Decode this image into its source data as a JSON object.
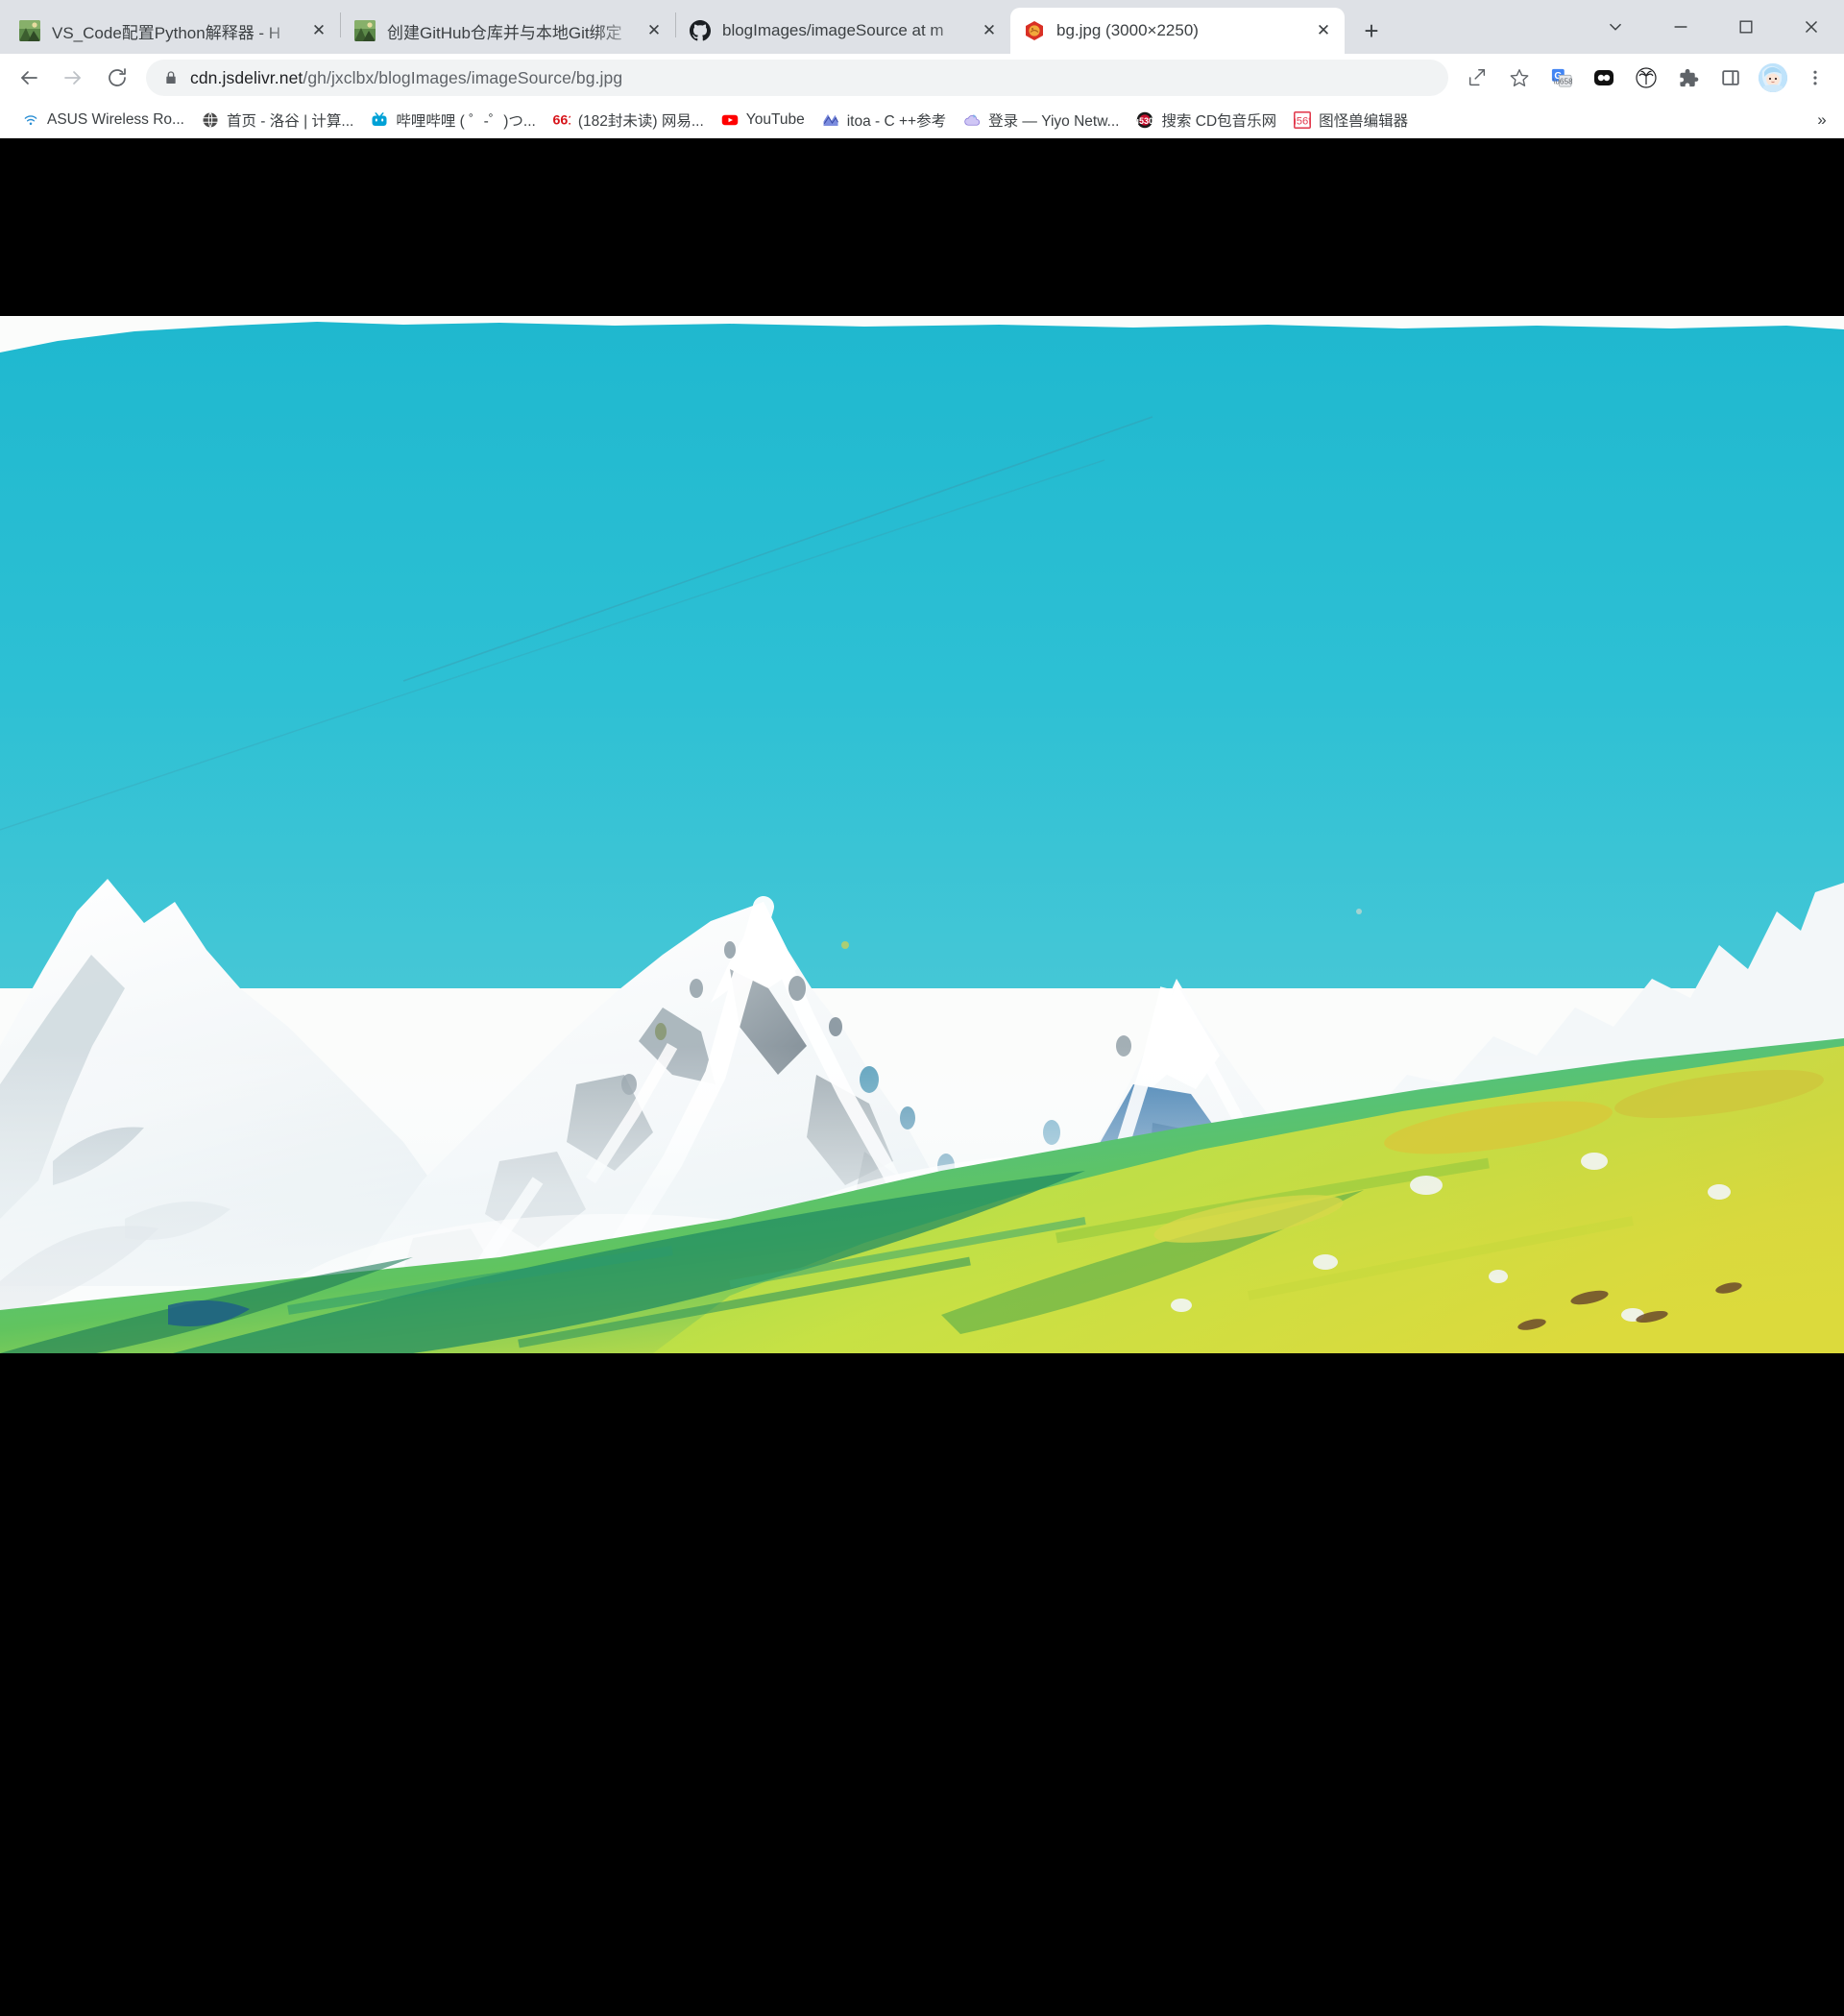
{
  "window": {
    "controls": [
      {
        "name": "tab-search-button",
        "glyph": "⌄"
      },
      {
        "name": "minimize-button",
        "glyph": "—"
      },
      {
        "name": "maximize-button",
        "glyph": "□"
      },
      {
        "name": "close-button",
        "glyph": "✕"
      }
    ]
  },
  "tabs": [
    {
      "title": "VS_Code配置Python解释器 - H",
      "favicon": "photo-thumb",
      "active": false,
      "close_label": "✕"
    },
    {
      "title": "创建GitHub仓库并与本地Git绑定",
      "favicon": "photo-thumb",
      "active": false,
      "close_label": "✕"
    },
    {
      "title": "blogImages/imageSource at m",
      "favicon": "github-icon",
      "active": false,
      "close_label": "✕"
    },
    {
      "title": "bg.jpg (3000×2250)",
      "favicon": "jpg-file-icon",
      "active": true,
      "close_label": "✕"
    }
  ],
  "newtab": {
    "label": "+"
  },
  "toolbar": {
    "back_label": "←",
    "forward_label": "→",
    "reload_label": "⟳",
    "url_secure": "cdn.jsdelivr.net",
    "url_path": "/gh/jxclbx/blogImages/imageSource/bg.jpg",
    "url_full": "cdn.jsdelivr.net/gh/jxclbx/blogImages/imageSource/bg.jpg",
    "actions": [
      {
        "name": "share-icon"
      },
      {
        "name": "bookmark-star-icon"
      },
      {
        "name": "google-translate-icon"
      },
      {
        "name": "flickr-extension-icon"
      },
      {
        "name": "palm-tree-extension-icon"
      },
      {
        "name": "extensions-puzzle-icon"
      },
      {
        "name": "side-panel-icon"
      },
      {
        "name": "profile-avatar"
      },
      {
        "name": "chrome-menu-icon"
      }
    ]
  },
  "bookmarks": {
    "items": [
      {
        "label": "ASUS Wireless Ro...",
        "icon": "wifi-icon"
      },
      {
        "label": "首页 - 洛谷 | 计算...",
        "icon": "globe-icon"
      },
      {
        "label": "哔哩哔哩 ( ゜-゜)つ...",
        "icon": "bilibili-icon"
      },
      {
        "label": "(182封未读) 网易...",
        "icon": "netease-mail-icon"
      },
      {
        "label": "YouTube",
        "icon": "youtube-icon"
      },
      {
        "label": "itoa - C ++参考",
        "icon": "cppreference-icon"
      },
      {
        "label": "登录 — Yiyo Netw...",
        "icon": "cloud-icon"
      },
      {
        "label": "搜索 CD包音乐网",
        "icon": "cdbao-icon"
      },
      {
        "label": "图怪兽编辑器",
        "icon": "tuguaishou-icon"
      }
    ],
    "overflow_label": "»"
  },
  "viewer": {
    "image_name": "bg.jpg",
    "image_dimensions": "3000×2250",
    "background_color": "#000000",
    "alt": "Watercolor painting of snow-capped mountains under a turquoise sky with a bright green and yellow alpine meadow in the foreground"
  }
}
